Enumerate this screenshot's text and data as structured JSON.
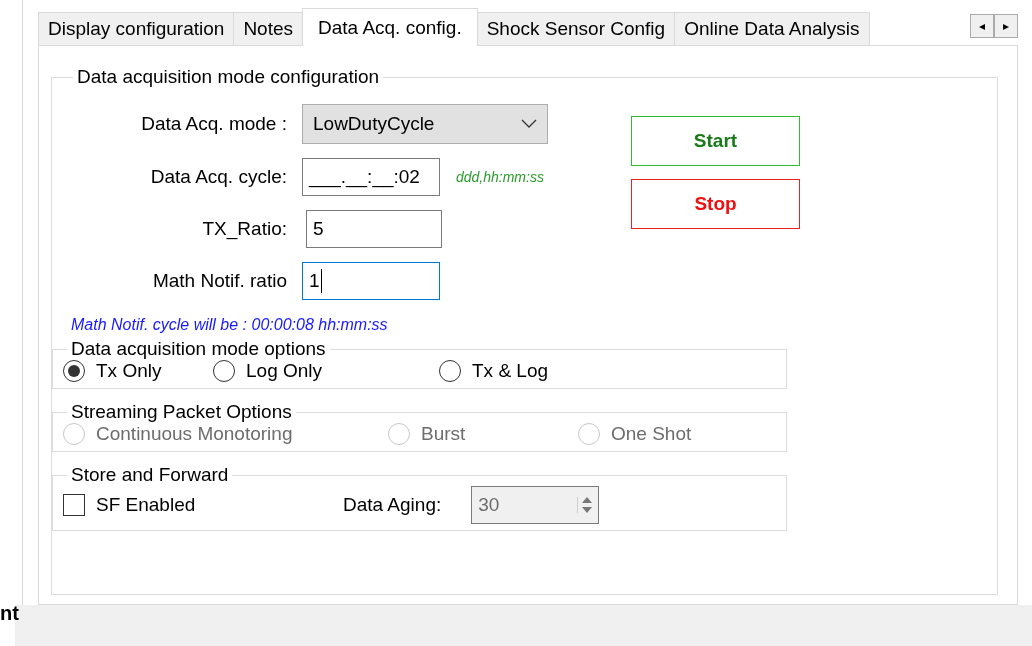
{
  "side_label": "nt",
  "tabs": [
    {
      "label": "Display configuration",
      "selected": false
    },
    {
      "label": "Notes",
      "selected": false
    },
    {
      "label": "Data Acq. config.",
      "selected": true
    },
    {
      "label": "Shock Sensor Config",
      "selected": false
    },
    {
      "label": "Online Data Analysis",
      "selected": false
    }
  ],
  "tab_scroll": [
    "◂",
    "▸"
  ],
  "group": {
    "title": "Data acquisition mode configuration",
    "mode": {
      "label": "Data Acq. mode :",
      "value": "LowDutyCycle"
    },
    "cycle": {
      "label": "Data Acq. cycle:",
      "value": "___.__:__:02",
      "hint": "ddd,hh:mm:ss"
    },
    "tx_ratio": {
      "label": "TX_Ratio:",
      "value": "5"
    },
    "math_ratio": {
      "label": "Math Notif. ratio",
      "value": "1",
      "focused": true
    },
    "math_note": "Math Notif. cycle will be : 00:00:08 hh:mm:ss",
    "buttons": [
      {
        "label": "Start",
        "kind": "start"
      },
      {
        "label": "Stop",
        "kind": "stop"
      }
    ],
    "mode_options": {
      "title": "Data acquisition mode options",
      "disabled": false,
      "options": [
        {
          "label": "Tx Only",
          "selected": true
        },
        {
          "label": "Log Only",
          "selected": false
        },
        {
          "label": "Tx & Log",
          "selected": false
        }
      ]
    },
    "streaming": {
      "title": "Streaming Packet Options",
      "disabled": true,
      "options": [
        {
          "label": "Continuous Monotoring",
          "selected": false
        },
        {
          "label": "Burst",
          "selected": false
        },
        {
          "label": "One Shot",
          "selected": false
        }
      ]
    },
    "store": {
      "title": "Store and Forward",
      "sf_enabled": {
        "label": "SF Enabled",
        "checked": false
      },
      "aging": {
        "label": "Data Aging:",
        "value": "30",
        "disabled": true
      }
    }
  }
}
